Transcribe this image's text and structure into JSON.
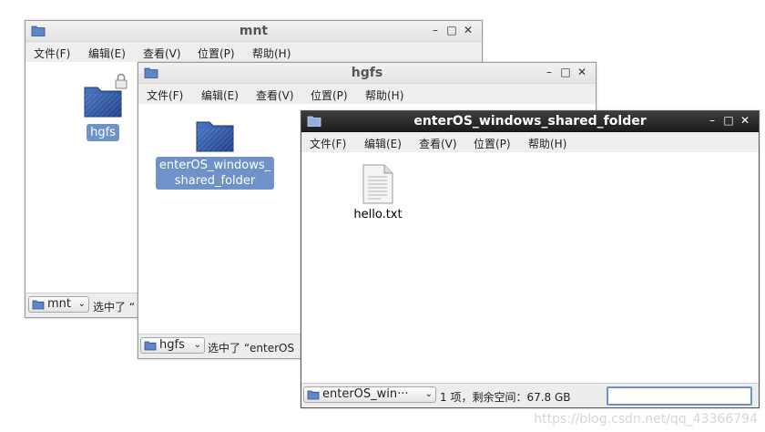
{
  "menu": {
    "file": "文件(F)",
    "edit": "编辑(E)",
    "view": "查看(V)",
    "location": "位置(P)",
    "help": "帮助(H)"
  },
  "window_buttons": {
    "minimize": "–",
    "maximize": "□",
    "close": "✕"
  },
  "window_mnt": {
    "title": "mnt",
    "items": [
      {
        "label": "hgfs",
        "icon": "folder-icon",
        "selected": true,
        "locked": true
      }
    ],
    "location": "mnt",
    "status": "选中了 “"
  },
  "window_hgfs": {
    "title": "hgfs",
    "items": [
      {
        "label_line1": "enterOS_windows_",
        "label_line2": "shared_folder",
        "icon": "folder-icon",
        "selected": true
      }
    ],
    "location": "hgfs",
    "status": "选中了 “enterOS"
  },
  "window_shared": {
    "title": "enterOS_windows_shared_folder",
    "items": [
      {
        "label": "hello.txt",
        "icon": "text-file-icon",
        "selected": false
      }
    ],
    "location": "enterOS_win···",
    "status": "1 项，剩余空间：67.8 GB",
    "input_value": ""
  },
  "watermark": "https://blog.csdn.net/qq_43366794",
  "colors": {
    "folder_blue": "#2c56a3",
    "selection": "#6f93c9",
    "active_title": "#2a2a2a"
  }
}
